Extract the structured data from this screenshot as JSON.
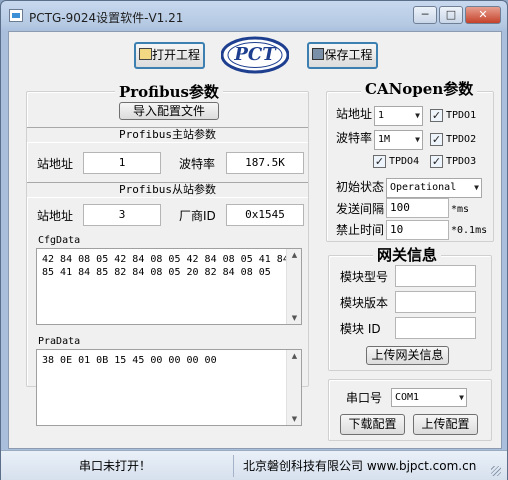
{
  "window": {
    "title": "PCTG-9024设置软件-V1.21",
    "minimize": "─",
    "maximize": "□",
    "close": "✕"
  },
  "toolbar": {
    "open_label": "打开工程",
    "save_label": "保存工程",
    "logo_text": "PCT"
  },
  "profibus": {
    "title": "Profibus参数",
    "import_button": "导入配置文件",
    "master_heading": "Profibus主站参数",
    "master": {
      "station_label": "站地址",
      "station_value": "1",
      "baud_label": "波特率",
      "baud_value": "187.5K"
    },
    "slave_heading": "Profibus从站参数",
    "slave": {
      "station_label": "站地址",
      "station_value": "3",
      "vendor_label": "厂商ID",
      "vendor_value": "0x1545"
    },
    "cfg_label": "CfgData",
    "cfg_data": "42 84 08 05 42 84 08 05 42 84 08 05 41 84\n85 41 84 85 82 84 08 05 20 82 84 08 05",
    "pra_label": "PraData",
    "pra_data": "38 0E 01 0B 15 45 00 00 00 00"
  },
  "canopen": {
    "title": "CANopen参数",
    "station_label": "站地址",
    "station_value": "1",
    "baud_label": "波特率",
    "baud_value": "1M",
    "tpdo1": "TPDO1",
    "tpdo2": "TPDO2",
    "tpdo3": "TPDO3",
    "tpdo4": "TPDO4",
    "init_label": "初始状态",
    "init_value": "Operational",
    "send_label": "发送间隔",
    "send_value": "100",
    "send_unit": "*ms",
    "inhibit_label": "禁止时间",
    "inhibit_value": "10",
    "inhibit_unit": "*0.1ms"
  },
  "gateway": {
    "title": "网关信息",
    "model_label": "模块型号",
    "model_value": "",
    "version_label": "模块版本",
    "version_value": "",
    "id_label": "模块 ID",
    "id_value": "",
    "upload_button": "上传网关信息"
  },
  "serial": {
    "port_label": "串口号",
    "port_value": "COM1",
    "download_button": "下载配置",
    "upload_button": "上传配置"
  },
  "statusbar": {
    "port_status": "串口未打开！",
    "company": "北京磐创科技有限公司 www.bjpct.com.cn"
  }
}
